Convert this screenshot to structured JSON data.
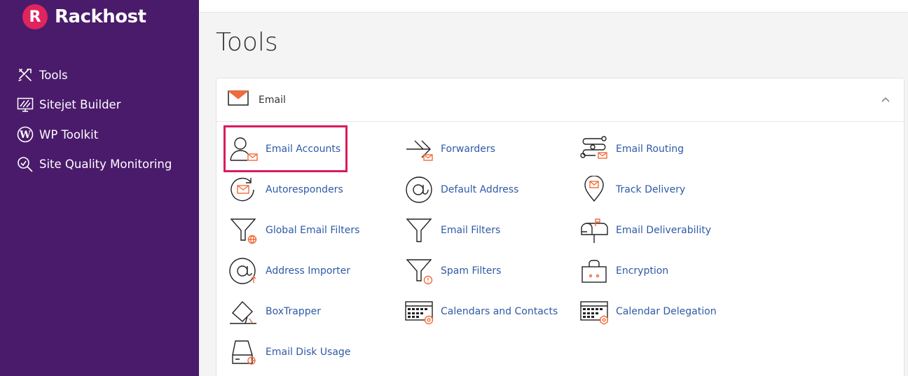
{
  "brand": {
    "mark": "R",
    "name": "Rackhost",
    "accent": "#e0245e",
    "sidebar_bg": "#4a1b6b"
  },
  "sidebar": {
    "items": [
      {
        "label": "Tools",
        "icon": "tools-icon"
      },
      {
        "label": "Sitejet Builder",
        "icon": "monitor-icon"
      },
      {
        "label": "WP Toolkit",
        "icon": "wordpress-icon"
      },
      {
        "label": "Site Quality Monitoring",
        "icon": "magnifier-icon"
      }
    ]
  },
  "page": {
    "title": "Tools"
  },
  "section": {
    "title": "Email",
    "tools": [
      {
        "label": "Email Accounts",
        "icon": "email-accounts-icon",
        "highlighted": true
      },
      {
        "label": "Forwarders",
        "icon": "forwarders-icon"
      },
      {
        "label": "Email Routing",
        "icon": "email-routing-icon"
      },
      {
        "label": "Autoresponders",
        "icon": "autoresponders-icon"
      },
      {
        "label": "Default Address",
        "icon": "at-sign-icon"
      },
      {
        "label": "Track Delivery",
        "icon": "location-pin-icon"
      },
      {
        "label": "Global Email Filters",
        "icon": "global-filter-icon"
      },
      {
        "label": "Email Filters",
        "icon": "filter-icon"
      },
      {
        "label": "Email Deliverability",
        "icon": "mailbox-icon"
      },
      {
        "label": "Address Importer",
        "icon": "address-importer-icon"
      },
      {
        "label": "Spam Filters",
        "icon": "spam-filter-icon"
      },
      {
        "label": "Encryption",
        "icon": "encryption-icon"
      },
      {
        "label": "BoxTrapper",
        "icon": "boxtrapper-icon"
      },
      {
        "label": "Calendars and Contacts",
        "icon": "calendar-contacts-icon"
      },
      {
        "label": "Calendar Delegation",
        "icon": "calendar-delegation-icon"
      },
      {
        "label": "Email Disk Usage",
        "icon": "disk-usage-icon"
      }
    ]
  },
  "colors": {
    "link": "#2e5aa6",
    "icon_accent": "#f26b3a",
    "highlight_border": "#d81b60"
  }
}
